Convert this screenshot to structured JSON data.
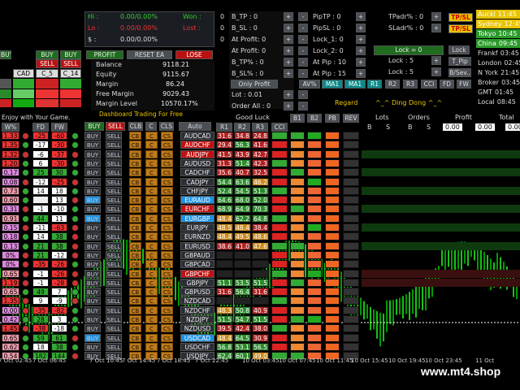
{
  "top_stats": {
    "hi_label": "Hi :",
    "hi_value": "0.00/0.00%",
    "lo_label": "Lo :",
    "lo_value": "0.00/0.00%",
    "dollar_label": "$ :",
    "dollar_value": "0.00/0.00%",
    "won_label": "Won :",
    "won_value": "0",
    "lost_label": "Lost :",
    "lost_value": "0",
    "count_value": "0"
  },
  "left_buttons": {
    "buy1": "BUY",
    "buy2": "BUY",
    "buy3": "BUY",
    "sell1": "SELL",
    "sell2": "SELL",
    "cad": "CAD",
    "c5": "C_5",
    "c14": "C_14"
  },
  "account": {
    "profit_btn": "PROFIT",
    "reset_btn": "RESET EA",
    "lose_btn": "LOSE",
    "balance_label": "Balance",
    "balance": "9118.21",
    "equity_label": "Equity",
    "equity": "9115.67",
    "margin_label": "Margin",
    "margin": "86.24",
    "free_margin_label": "Free Margin",
    "free_margin": "9029.43",
    "margin_level_label": "Margin Level",
    "margin_level": "10570.17%",
    "banner": "Dashboard Trading For Free"
  },
  "enjoy_text": "Enjoy with Your Game.",
  "col_headers": {
    "w": "W%",
    "fd": "FD",
    "fw": "FW",
    "buy": "BUY",
    "sell": "SELL",
    "clb": "CLB",
    "c": "C",
    "cls": "CLS",
    "auto": "Auto",
    "good_luck": "Good Luck",
    "r1": "R1",
    "r2": "R2",
    "r3": "R3",
    "cci": "CCI",
    "b1": "B1",
    "b2": "B2",
    "pb": "PB",
    "rev": "REV",
    "lots": "Lots",
    "orders": "Orders",
    "profit": "Profit",
    "total": "Total",
    "b": "B",
    "s": "S"
  },
  "tp_sl": {
    "b_tp": "B_TP : 0",
    "b_sl": "B_SL : 0",
    "at_profit1": "At Profit: 0",
    "at_profit2": "At Profit: 0",
    "b_tp_pct": "B_TP% : 0",
    "b_sl_pct": "B_SL% : 0",
    "only_profit": "Only Profit",
    "lot": "Lot : 0.01",
    "order_all": "Order All : 0",
    "minus": "-",
    "plus": "+"
  },
  "pip": {
    "piptp": "PipTP : 0",
    "pipsl": "PipSL : 0",
    "lock1": "Lock_1: 0",
    "lock2": "Lock_2: 0",
    "atpip1": "At Pip : 10",
    "atpip2": "At Pip : 15",
    "tpadr": "TPadr% : 0",
    "sladr": "SLadr% : 0",
    "tp_sl_btn": "TP/SL",
    "lock": "Lock = 0",
    "lock_btn": "Lock",
    "lock5a": "Lock : 5",
    "lock5b": "Lock : 5",
    "tpip": "T_Pip",
    "bseven": "B/Sev.."
  },
  "indicators": {
    "av": "AV%",
    "ma1a": "MA1",
    "ma1b": "MA1",
    "r1": "R1",
    "r2": "R2",
    "r3": "R3",
    "cci": "CCI",
    "fd": "FD",
    "fw": "FW",
    "regard": "Regard",
    "ding": "^_^ Ding Dong ^_^"
  },
  "clocks": [
    {
      "name": "Auckl",
      "time": "11:45"
    },
    {
      "name": "Sydney",
      "time": "12:45"
    },
    {
      "name": "Tokyo",
      "time": "10:45"
    },
    {
      "name": "China",
      "time": "09:45"
    },
    {
      "name": "Frankf",
      "time": "03:45"
    },
    {
      "name": "London",
      "time": "02:45"
    },
    {
      "name": "N York",
      "time": "21:45"
    },
    {
      "name": "Broker",
      "time": "03:45"
    },
    {
      "name": "GMT",
      "time": "01:45"
    },
    {
      "name": "Local",
      "time": "08:45"
    }
  ],
  "pairs": [
    "AUDCAD",
    "AUDCHF",
    "AUDJPY",
    "AUDUSD",
    "CADCHF",
    "CADJPY",
    "CHFJPY",
    "EURAUD",
    "EURCHF",
    "EURGBP",
    "EURJPY",
    "EURNZD",
    "EURUSD",
    "GBPAUD",
    "GBPCAD",
    "GBPCHF",
    "GBPJPY",
    "GBPUSD",
    "NZDCAD",
    "NZDCHF",
    "NZDJPY",
    "NZDUSD",
    "USDCAD",
    "USDCHF",
    "USDJPY"
  ],
  "pair_highlight": {
    "AUDCHF": "r",
    "AUDJPY": "r",
    "EURAUD": "b",
    "EURCHF": "r",
    "EURGBP": "b",
    "GBPCHF": "r",
    "USDCAD": "b"
  },
  "rvals": [
    [
      "31.6",
      "34.8",
      "24.8"
    ],
    [
      "29.4",
      "56.3",
      "41.6"
    ],
    [
      "41.5",
      "43.9",
      "42.7"
    ],
    [
      "31.3",
      "51.4",
      "42.3"
    ],
    [
      "35.6",
      "40.7",
      "32.5"
    ],
    [
      "54.4",
      "63.6",
      "46.2"
    ],
    [
      "52.4",
      "54.5",
      "51.3"
    ],
    [
      "64.6",
      "68.0",
      "52.0"
    ],
    [
      "68.9",
      "64.9",
      "70.3"
    ],
    [
      "48.4",
      "62.2",
      "64.8"
    ],
    [
      "48.5",
      "48.4",
      "38.4"
    ],
    [
      "48.4",
      "49.5",
      "48.6"
    ],
    [
      "38.6",
      "41.0",
      "47.6"
    ],
    [
      "",
      "",
      " "
    ],
    [
      "",
      "",
      ""
    ],
    [
      "",
      "",
      ""
    ],
    [
      "51.1",
      "53.5",
      "51.5"
    ],
    [
      "31.6",
      "56.4",
      "31.6"
    ],
    [
      "",
      "",
      ""
    ],
    [
      "48.3",
      "50.8",
      "40.9"
    ],
    [
      "51.5",
      "54.7",
      "51.5"
    ],
    [
      "39.5",
      "42.4",
      "38.0"
    ],
    [
      "48.4",
      "64.5",
      "30.9"
    ],
    [
      "56.8",
      "53.1",
      "56.5"
    ],
    [
      "62.4",
      "60.1",
      "49.0"
    ]
  ],
  "left_nums": [
    [
      "1.33",
      "-25",
      "-60"
    ],
    [
      "1.35",
      "-17",
      "-30"
    ],
    [
      "1.32",
      "-6",
      "-37"
    ],
    [
      "1.20",
      "6",
      "-30"
    ],
    [
      "0.17",
      "25",
      "30"
    ],
    [
      "0.08",
      "-12",
      "-25"
    ],
    [
      "0.73",
      "14",
      "18"
    ],
    [
      "0.60",
      "",
      "13"
    ],
    [
      "0.31",
      "-1",
      "-10"
    ],
    [
      "0.91",
      "44",
      "11"
    ],
    [
      "0.15",
      "-11",
      "-63"
    ],
    [
      "0.18",
      "14",
      "38"
    ],
    [
      "0.13",
      "21",
      "38"
    ],
    [
      "0%",
      "21",
      "-12"
    ],
    [
      "0%",
      "-35",
      "-26"
    ],
    [
      "0.65",
      "-1",
      "-26"
    ],
    [
      "1.19",
      "-1",
      "-28"
    ],
    [
      "0.65",
      "49",
      "7"
    ],
    [
      "1.35",
      "9",
      "-9"
    ],
    [
      "0.00",
      "-35",
      "-82"
    ],
    [
      "0.42",
      "28",
      "3"
    ],
    [
      "1.45",
      "-38",
      "-18"
    ],
    [
      "0.65",
      "59",
      "61"
    ],
    [
      "0.62",
      "18",
      "38"
    ],
    [
      "0.54",
      "182",
      "144"
    ]
  ],
  "times": [
    "7 Oct 02:45",
    "7 Oct 06:45",
    "7 Oct 10:45",
    "7 Oct 14:45",
    "7 Oct 18:45",
    "7 Oct 22:45",
    "10 Oct 03:45",
    "10 Oct 07:45",
    "10 Oct 11:45",
    "10 Oct 15:45",
    "10 Oct 19:45",
    "10 Oct 23:45",
    "11 Oct"
  ],
  "watermark": "www.mt4.shop",
  "zeros": [
    "0.00",
    "0.00",
    "0.00",
    "0.00"
  ]
}
